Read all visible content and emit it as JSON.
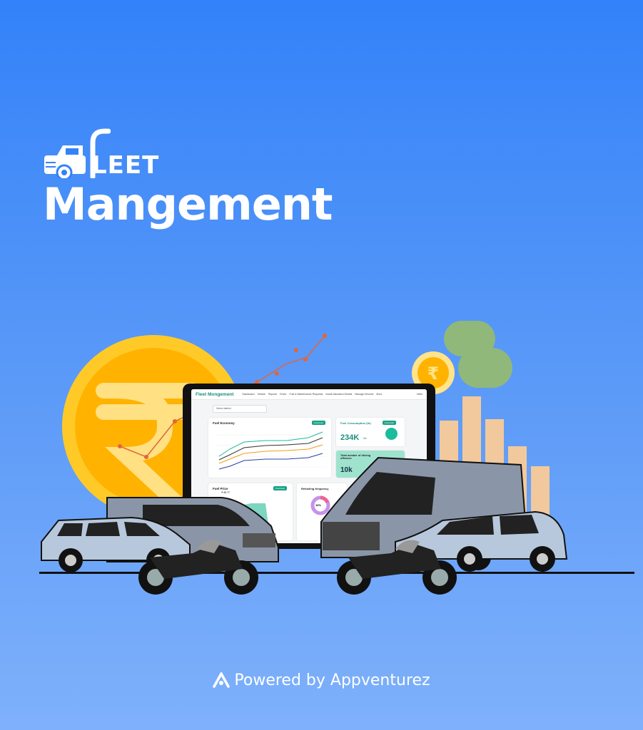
{
  "brand": {
    "fleet_word": "LEET",
    "title": "Mangement"
  },
  "footer": {
    "text": "Powered by Appventurez"
  },
  "dashboard": {
    "app_title": "Fleet Mongement",
    "nav": [
      "Dashboard",
      "Vehicle",
      "Reports",
      "Driver",
      "Fuel & Maintenance Requests",
      "Inside Allocation Details",
      "Manage Devices",
      "More"
    ],
    "user": "Hello",
    "district_select": "Select district",
    "fuel_economy": {
      "title": "Fuel Economy",
      "download": "Download"
    },
    "fuel_consumption": {
      "title": "Fuel Consumption (ltr)",
      "value": "234K",
      "unit": "ltrs",
      "download": "Download"
    },
    "driving_offenses": {
      "title": "Total number of driving offenses",
      "value": "10k"
    },
    "fuel_price": {
      "title": "Fuel Price",
      "value": "₹ 95.77",
      "download": "Download"
    },
    "refueling": {
      "title": "Refueling frequency",
      "value": "10%"
    }
  },
  "colors": {
    "bg_top": "#3382f9",
    "accent_green": "#16a085",
    "coin": "#ffc21a",
    "van_grey": "#8a96a8"
  }
}
